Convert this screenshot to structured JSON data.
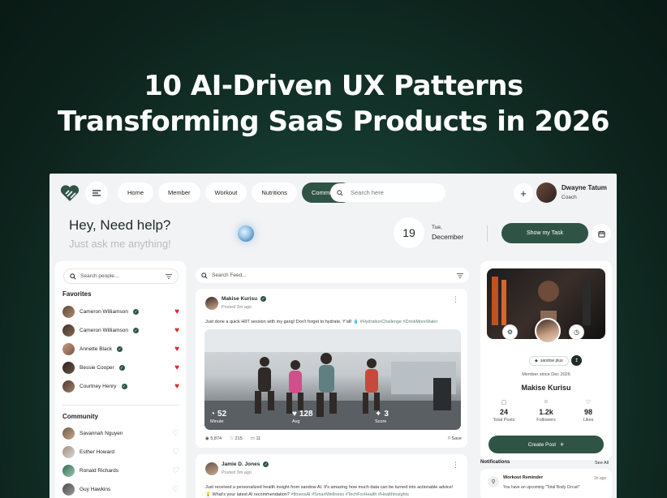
{
  "headline": {
    "line1": "10 AI-Driven UX Patterns",
    "line2": "Transforming SaaS Products in 2026"
  },
  "colors": {
    "brand": "#2f5446",
    "heart": "#e0262f",
    "bg_dark": "#0d231c"
  },
  "topbar": {
    "nav": [
      "Home",
      "Member",
      "Workout",
      "Nutritions",
      "Community"
    ],
    "active_nav": "Community",
    "search_placeholder": "Search here",
    "user": {
      "name": "Dwayne Tatum",
      "role": "Coach"
    }
  },
  "greeting": {
    "title": "Hey, Need help?",
    "subtitle": "Just ask me anything!"
  },
  "date": {
    "day_num": "19",
    "weekday": "Tue,",
    "month": "December"
  },
  "show_task_label": "Show my Task",
  "left": {
    "search_placeholder": "Search people...",
    "favorites_title": "Favorites",
    "favorites": [
      "Cameron Williamson",
      "Cameron Williamson",
      "Annette Black",
      "Bessie Cooper",
      "Courtney Henry"
    ],
    "community_title": "Community",
    "community": [
      "Savannah Nguyen",
      "Esther Howard",
      "Ronald Richards",
      "Guy Hawkins"
    ]
  },
  "feed": {
    "search_placeholder": "Search Feed...",
    "post1": {
      "name": "Makise Kurisu",
      "time": "Posted 3m ago",
      "text": "Just done a quick HIIT session with my gang! Don't forget to hydrate, Y'all! 💧",
      "tags": "#HydrationChallenge #DrinkMoreWater",
      "stats": [
        {
          "value": "52",
          "label": "Minute"
        },
        {
          "value": "128",
          "label": "Avg"
        },
        {
          "value": "3",
          "label": "Score"
        }
      ],
      "views": "5,874",
      "likes": "215",
      "comments": "11",
      "save": "Save"
    },
    "post2": {
      "name": "Jamie D. Jones",
      "time": "Posted 3m ago",
      "text": "Just received a personalized health insight from sandow AI. It's amazing how much data can be turned into actionable advice!",
      "text2": "💡 What's your latest AI recommendation?",
      "tags": "#fitnessAI #SmartWellness #TechForHealth #HealthInsights"
    }
  },
  "profile": {
    "plan": "sandow plus",
    "member_since": "Member since Dec 2026",
    "name": "Makise Kurisu",
    "stats": [
      {
        "value": "24",
        "label": "Total Posts"
      },
      {
        "value": "1.2k",
        "label": "Followers"
      },
      {
        "value": "98",
        "label": "Likes"
      }
    ],
    "create_post": "Create Post"
  },
  "notifications": {
    "title": "Notifications",
    "see_all": "See All",
    "item": {
      "name": "Workout Reminder",
      "time": "1h ago",
      "text": "You have an upcoming \"Total Body Circuit\""
    }
  }
}
